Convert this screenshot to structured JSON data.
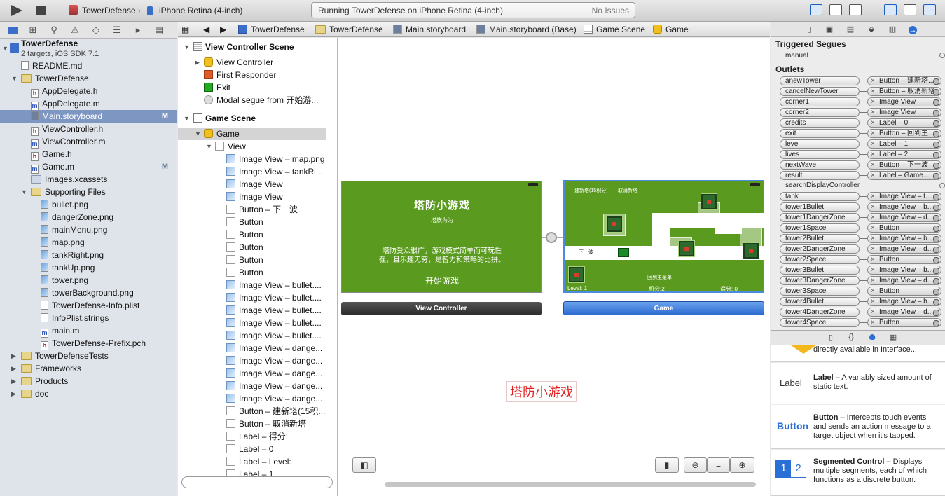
{
  "toolbar": {
    "scheme": "TowerDefense",
    "device": "iPhone Retina (4-inch)",
    "status": "Running TowerDefense on iPhone Retina (4-inch)",
    "issues": "No Issues"
  },
  "navigator": {
    "project": "TowerDefense",
    "project_sub": "2 targets, iOS SDK 7.1",
    "rows": [
      {
        "label": "README.md",
        "kind": "file",
        "indent": 1,
        "badge": ""
      },
      {
        "label": "TowerDefense",
        "kind": "folder",
        "indent": 1,
        "badge": ""
      },
      {
        "label": "AppDelegate.h",
        "kind": "h",
        "indent": 2,
        "badge": ""
      },
      {
        "label": "AppDelegate.m",
        "kind": "m",
        "indent": 2,
        "badge": ""
      },
      {
        "label": "Main.storyboard",
        "kind": "sb",
        "indent": 2,
        "badge": "M"
      },
      {
        "label": "ViewController.h",
        "kind": "h",
        "indent": 2,
        "badge": ""
      },
      {
        "label": "ViewController.m",
        "kind": "m",
        "indent": 2,
        "badge": ""
      },
      {
        "label": "Game.h",
        "kind": "h",
        "indent": 2,
        "badge": ""
      },
      {
        "label": "Game.m",
        "kind": "m",
        "indent": 2,
        "badge": "M"
      },
      {
        "label": "Images.xcassets",
        "kind": "assets",
        "indent": 2,
        "badge": ""
      },
      {
        "label": "Supporting Files",
        "kind": "folder",
        "indent": 2,
        "badge": ""
      },
      {
        "label": "bullet.png",
        "kind": "img",
        "indent": 3,
        "badge": ""
      },
      {
        "label": "dangerZone.png",
        "kind": "img",
        "indent": 3,
        "badge": ""
      },
      {
        "label": "mainMenu.png",
        "kind": "img",
        "indent": 3,
        "badge": ""
      },
      {
        "label": "map.png",
        "kind": "img",
        "indent": 3,
        "badge": ""
      },
      {
        "label": "tankRight.png",
        "kind": "img",
        "indent": 3,
        "badge": ""
      },
      {
        "label": "tankUp.png",
        "kind": "img",
        "indent": 3,
        "badge": ""
      },
      {
        "label": "tower.png",
        "kind": "img",
        "indent": 3,
        "badge": ""
      },
      {
        "label": "towerBackground.png",
        "kind": "img",
        "indent": 3,
        "badge": ""
      },
      {
        "label": "TowerDefense-Info.plist",
        "kind": "file",
        "indent": 3,
        "badge": ""
      },
      {
        "label": "InfoPlist.strings",
        "kind": "file",
        "indent": 3,
        "badge": ""
      },
      {
        "label": "main.m",
        "kind": "m",
        "indent": 3,
        "badge": ""
      },
      {
        "label": "TowerDefense-Prefix.pch",
        "kind": "h",
        "indent": 3,
        "badge": ""
      },
      {
        "label": "TowerDefenseTests",
        "kind": "folder",
        "indent": 1,
        "badge": ""
      },
      {
        "label": "Frameworks",
        "kind": "folder",
        "indent": 1,
        "badge": ""
      },
      {
        "label": "Products",
        "kind": "folder",
        "indent": 1,
        "badge": ""
      },
      {
        "label": "doc",
        "kind": "folder",
        "indent": 1,
        "badge": ""
      }
    ]
  },
  "jumpbar": [
    "TowerDefense",
    "TowerDefense",
    "Main.storyboard",
    "Main.storyboard (Base)",
    "Game Scene",
    "Game"
  ],
  "outline": {
    "vc_scene": "View Controller Scene",
    "vc_items": [
      "View Controller",
      "First Responder",
      "Exit",
      "Modal segue from 开始游..."
    ],
    "game_scene": "Game Scene",
    "game": "Game",
    "view": "View",
    "items": [
      "Image View – map.png",
      "Image View – tankRi...",
      "Image View",
      "Image View",
      "Button – 下一波",
      "Button",
      "Button",
      "Button",
      "Button",
      "Button",
      "Image View – bullet....",
      "Image View – bullet....",
      "Image View – bullet....",
      "Image View – bullet....",
      "Image View – bullet....",
      "Image View – dange...",
      "Image View – dange...",
      "Image View – dange...",
      "Image View – dange...",
      "Image View – dange...",
      "Button – 建新塔(15积...",
      "Button – 取消新塔",
      "Label – 得分:",
      "Label – 0",
      "Label – Level:",
      "Label – 1"
    ]
  },
  "canvas": {
    "menu": {
      "title": "塔防小游戏",
      "subtitle": "塔族为为",
      "desc1": "塔防受众很广，游戏模式简单而可玩性",
      "desc2": "强，且乐趣无穷，是智力和策略的比拼。",
      "start": "开始游戏",
      "bar": "View Controller"
    },
    "game": {
      "build": "建新塔(15积分)",
      "cancel": "取消新塔",
      "next": "下一波",
      "main": "回到主菜单",
      "level": "Level: 1",
      "chance": "机会:2",
      "score": "得分:  0",
      "bar": "Game"
    },
    "note": "塔防小游戏"
  },
  "inspector": {
    "triggered": "Triggered Segues",
    "manual": "manual",
    "outlets_title": "Outlets",
    "outlets": [
      {
        "name": "anewTower",
        "to": "Button – 建新塔..."
      },
      {
        "name": "cancelNewTower",
        "to": "Button – 取消新塔"
      },
      {
        "name": "corner1",
        "to": "Image View"
      },
      {
        "name": "corner2",
        "to": "Image View"
      },
      {
        "name": "credits",
        "to": "Label – 0"
      },
      {
        "name": "exit",
        "to": "Button – 回到主..."
      },
      {
        "name": "level",
        "to": "Label – 1"
      },
      {
        "name": "lives",
        "to": "Label – 2"
      },
      {
        "name": "nextWave",
        "to": "Button – 下一波"
      },
      {
        "name": "result",
        "to": "Label – Game..."
      },
      {
        "name": "searchDisplayController",
        "to": ""
      },
      {
        "name": "tank",
        "to": "Image View – t..."
      },
      {
        "name": "tower1Bullet",
        "to": "Image View – b..."
      },
      {
        "name": "tower1DangerZone",
        "to": "Image View – d..."
      },
      {
        "name": "tower1Space",
        "to": "Button"
      },
      {
        "name": "tower2Bullet",
        "to": "Image View – b..."
      },
      {
        "name": "tower2DangerZone",
        "to": "Image View – d..."
      },
      {
        "name": "tower2Space",
        "to": "Button"
      },
      {
        "name": "tower3Bullet",
        "to": "Image View – b..."
      },
      {
        "name": "tower3DangerZone",
        "to": "Image View – d..."
      },
      {
        "name": "tower3Space",
        "to": "Button"
      },
      {
        "name": "tower4Bullet",
        "to": "Image View – b..."
      },
      {
        "name": "tower4DangerZone",
        "to": "Image View – d..."
      },
      {
        "name": "tower4Space",
        "to": "Button"
      }
    ],
    "library": [
      {
        "icon": "",
        "title": "",
        "desc": "directly available in Interface..."
      },
      {
        "icon": "Label",
        "title": "Label",
        "desc": " – A variably sized amount of static text."
      },
      {
        "icon": "Button",
        "title": "Button",
        "desc": " – Intercepts touch events and sends an action message to a target object when it's tapped."
      },
      {
        "icon": "",
        "title": "Segmented Control",
        "desc": " – Displays multiple segments, each of which functions as a discrete button."
      }
    ],
    "seg_labels": [
      "1",
      "2"
    ]
  }
}
